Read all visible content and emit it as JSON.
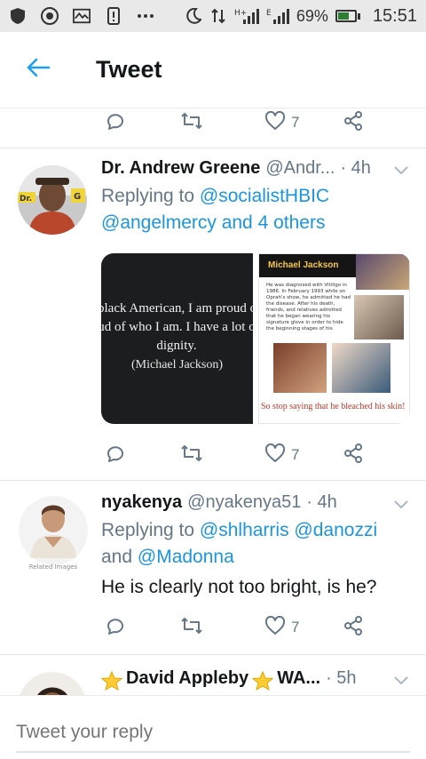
{
  "statusbar": {
    "network": "H+",
    "network2": "E",
    "battery": "69%",
    "time": "15:51"
  },
  "header": {
    "title": "Tweet"
  },
  "top_actions": {
    "like_count": "7"
  },
  "tweets": [
    {
      "name": "Dr. Andrew Greene",
      "handle": "@Andr...",
      "time": "· 4h",
      "reply_prefix": "Replying to",
      "reply_link1": "@socialistHBIC",
      "reply_link2": "@angelmercy and 4 others",
      "like_count": "7",
      "media": {
        "quote_line1": "black American, I am proud of",
        "quote_line2": "ud of who I am. I have a lot o",
        "quote_line3": "dignity.",
        "attribution": "(Michael Jackson)",
        "panel_title": "Michael Jackson",
        "panel_text": "He was diagnosed with Vitiligo in 1986. In February 1993 while on Oprah's show, he admitted he had the disease. After his death, friends, and relatives admitted that he began wearing his signature glove in order to hide the beginning stages of his",
        "panel_caption": "So stop saying that he bleached his skin!"
      }
    },
    {
      "name": "nyakenya",
      "handle": "@nyakenya51",
      "time": "· 4h",
      "reply_prefix": "Replying to",
      "reply_link1": "@shlharris @danozzi",
      "reply_and": "and",
      "reply_link2": "@Madonna",
      "text": "He is clearly not too bright, is he?",
      "like_count": "7",
      "avatar_caption": "Related Images"
    },
    {
      "name": "David Appleby",
      "name2": "WA...",
      "time": "· 5h"
    }
  ],
  "reply_box": {
    "placeholder": "Tweet your reply"
  },
  "colors": {
    "accent": "#1da1f2",
    "link": "#1b95e0",
    "secondary": "#657786"
  }
}
